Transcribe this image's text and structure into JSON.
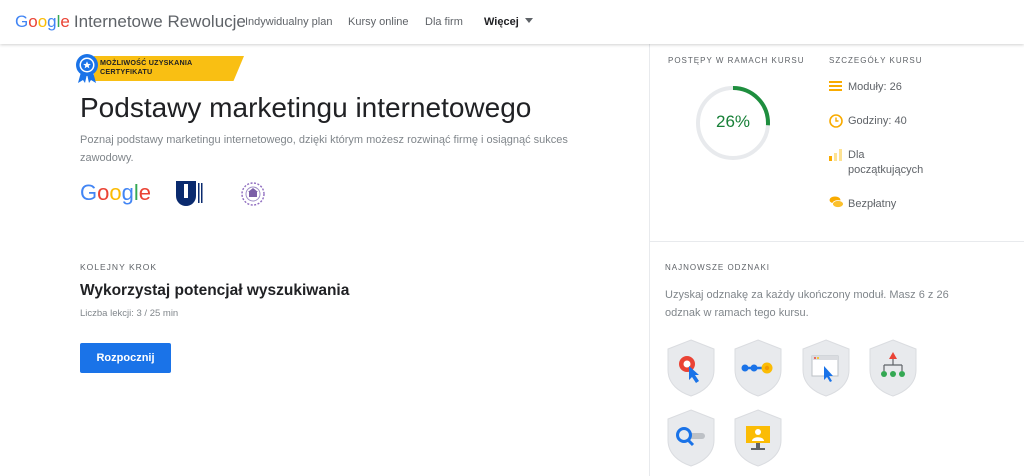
{
  "header": {
    "brand": "Google",
    "site_name": "Internetowe Rewolucje",
    "nav": [
      {
        "label": "Indywidualny plan"
      },
      {
        "label": "Kursy online"
      },
      {
        "label": "Dla firm"
      },
      {
        "label": "Więcej"
      }
    ]
  },
  "course": {
    "certificate_label": "MOŻLIWOŚĆ UZYSKANIA CERTYFIKATU",
    "title": "Podstawy marketingu internetowego",
    "description": "Poznaj podstawy marketingu internetowego, dzięki którym możesz rozwinąć firmę i osiągnąć sukces zawodowy.",
    "partners": {
      "google": "Google",
      "open_university": "The Open University"
    }
  },
  "next_step": {
    "label": "KOLEJNY KROK",
    "title": "Wykorzystaj potencjał wyszukiwania",
    "meta": "Liczba lekcji: 3 / 25 min",
    "button": "Rozpocznij"
  },
  "progress": {
    "label": "POSTĘPY W RAMACH KURSU",
    "percent": 26,
    "percent_text": "26%",
    "color": "#1e8e3e"
  },
  "details": {
    "label": "SZCZEGÓŁY KURSU",
    "items": [
      {
        "icon": "modules-icon",
        "text": "Moduły: 26"
      },
      {
        "icon": "clock-icon",
        "text": "Godziny: 40"
      },
      {
        "icon": "level-icon",
        "text": "Dla początkujących"
      },
      {
        "icon": "coins-icon",
        "text": "Bezpłatny"
      }
    ]
  },
  "badges": {
    "label": "NAJNOWSZE ODZNAKI",
    "description": "Uzyskaj odznakę za każdy ukończony moduł. Masz 6 z 26 odznak w ramach tego kursu.",
    "items": [
      {
        "icon": "click-target-icon"
      },
      {
        "icon": "connection-icon"
      },
      {
        "icon": "browser-cursor-icon"
      },
      {
        "icon": "network-tree-icon"
      },
      {
        "icon": "search-magnifier-icon"
      },
      {
        "icon": "presentation-icon"
      }
    ]
  },
  "colors": {
    "primary_button": "#1a73e8",
    "ribbon": "#f9bf13",
    "progress": "#1e8e3e"
  }
}
